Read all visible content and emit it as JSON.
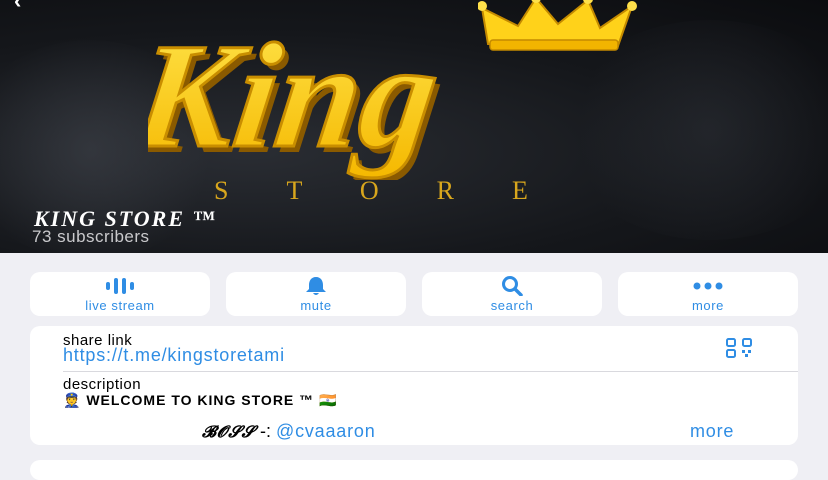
{
  "channel": {
    "title": "KING STORE ™",
    "subscribers": "73 subscribers",
    "logo": {
      "word": "King",
      "subword": "STORE",
      "colors": {
        "gold": "#ffd21a",
        "shadow": "#b07a00",
        "bg": "#15171b"
      }
    }
  },
  "actions": [
    {
      "label": "live stream",
      "icon": "live-stream-icon"
    },
    {
      "label": "mute",
      "icon": "bell-icon"
    },
    {
      "label": "search",
      "icon": "search-icon"
    },
    {
      "label": "more",
      "icon": "ellipsis-icon"
    }
  ],
  "info": {
    "share_label": "share link",
    "share_url": "https://t.me/kingstoretami",
    "description_label": "description",
    "description_emoji_left": "👮",
    "description_text": "WELCOME TO KING STORE ™",
    "description_emoji_right": "🇮🇳",
    "boss_label": "𝓑𝓞𝓢𝓢",
    "boss_separator": "-:",
    "boss_handle": "@cvaaaron",
    "more_label": "more"
  },
  "colors": {
    "accent": "#2f8de4",
    "background": "#efeff4",
    "card": "#ffffff"
  }
}
